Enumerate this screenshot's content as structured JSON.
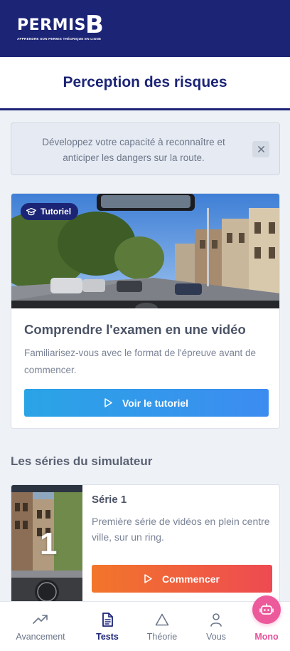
{
  "brand": {
    "logo_word": "PERMIS",
    "logo_letter": "B",
    "tagline": "APPRENDRE SON PERMIS THÉORIQUE EN LIGNE"
  },
  "header": {
    "title": "Perception des risques"
  },
  "info_banner": {
    "text": "Développez votre capacité à reconnaître et anticiper les dangers sur la route.",
    "close_icon": "close-icon"
  },
  "tutorial": {
    "badge_label": "Tutoriel",
    "badge_icon": "graduation-cap-icon",
    "title": "Comprendre l'examen en une vidéo",
    "description": "Familiarisez-vous avec le format de l'épreuve avant de commencer.",
    "button_label": "Voir le tutoriel",
    "button_icon": "play-icon"
  },
  "series_section": {
    "title": "Les séries du simulateur",
    "items": [
      {
        "number": "1",
        "title": "Série 1",
        "description": "Première série de vidéos en plein centre ville, sur un ring.",
        "button_label": "Commencer",
        "button_icon": "play-icon"
      }
    ]
  },
  "bottom_nav": {
    "items": [
      {
        "label": "Avancement",
        "icon": "trend-up-icon",
        "active": false
      },
      {
        "label": "Tests",
        "icon": "document-icon",
        "active": true
      },
      {
        "label": "Théorie",
        "icon": "triangle-icon",
        "active": false
      },
      {
        "label": "Vous",
        "icon": "user-icon",
        "active": false
      },
      {
        "label": "Mono",
        "icon": "robot-icon",
        "active": false
      }
    ]
  },
  "colors": {
    "brand_navy": "#1c2476",
    "tutorial_button": "#2aa4e6",
    "start_button": "#f2762a",
    "mono_pink": "#ec5a9b",
    "background": "#eef1f6"
  }
}
